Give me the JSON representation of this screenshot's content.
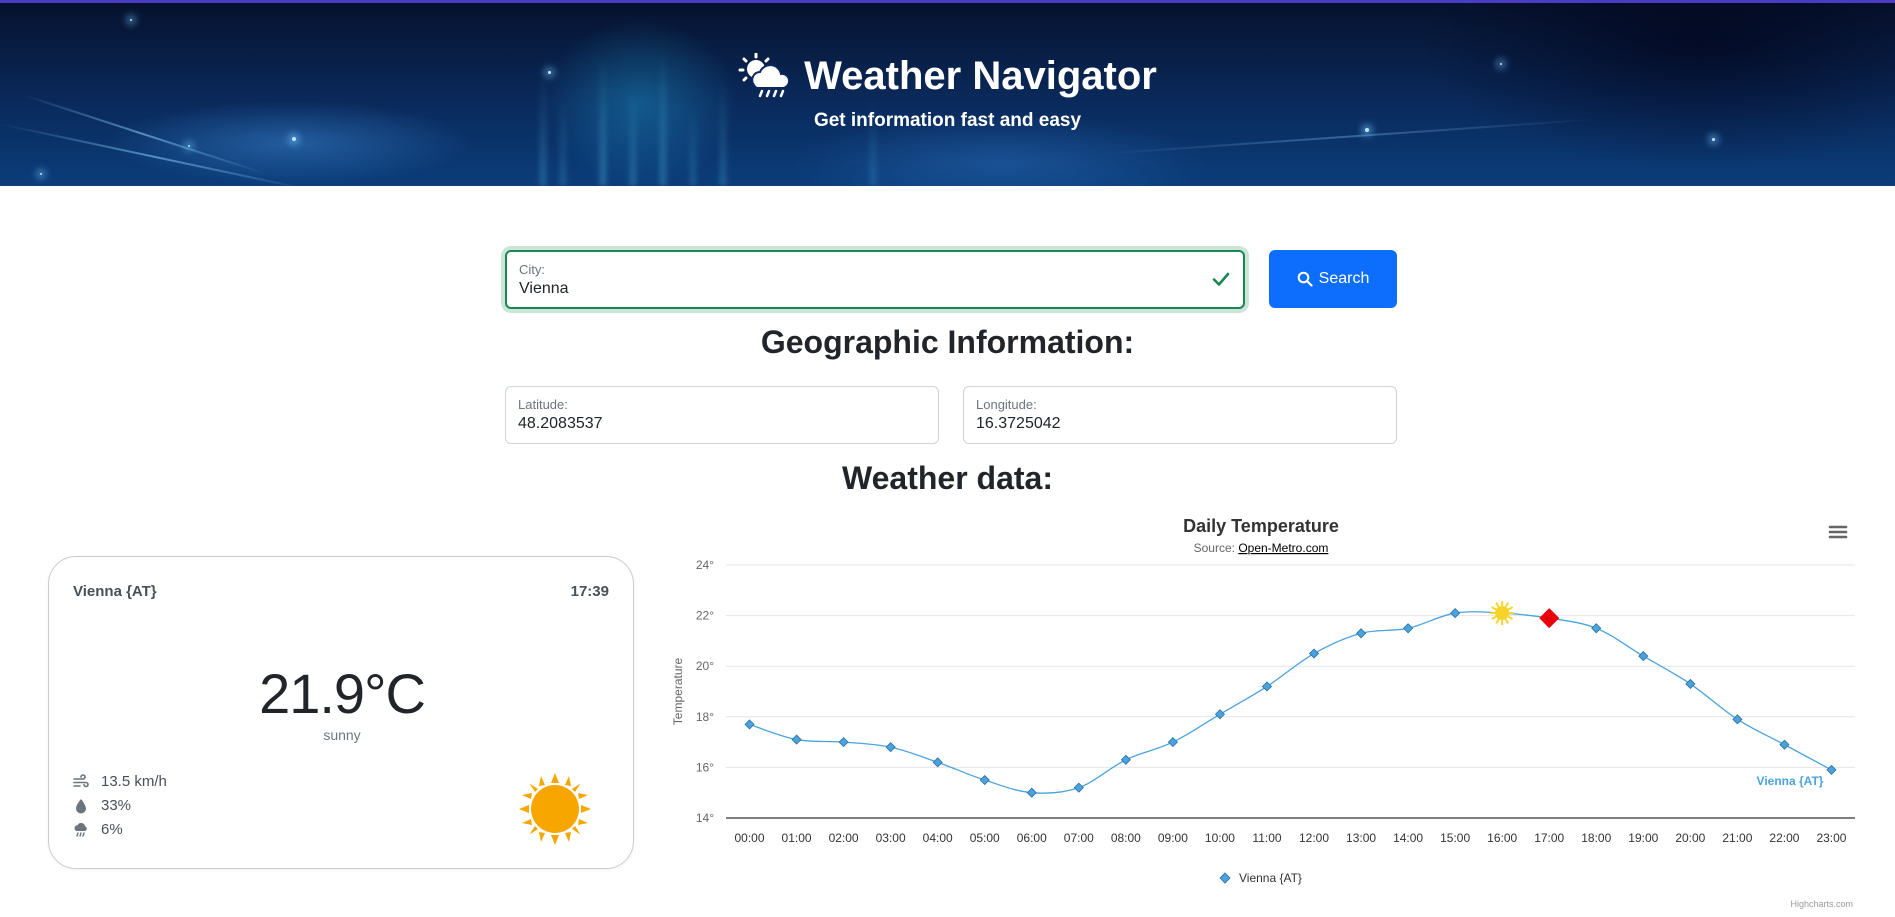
{
  "header": {
    "title": "Weather Navigator",
    "subtitle": "Get information fast and easy"
  },
  "search": {
    "city_label": "City:",
    "city_value": "Vienna",
    "button_label": "Search"
  },
  "geo": {
    "heading": "Geographic Information:",
    "latitude_label": "Latitude:",
    "latitude_value": "48.2083537",
    "longitude_label": "Longitude:",
    "longitude_value": "16.3725042"
  },
  "weather": {
    "heading": "Weather data:",
    "card": {
      "city": "Vienna {AT}",
      "time": "17:39",
      "temperature": "21.9°C",
      "condition": "sunny",
      "wind": "13.5 km/h",
      "humidity": "33%",
      "precipitation": "6%",
      "icon": "sun-icon"
    }
  },
  "chart_data": {
    "type": "line",
    "title": "Daily Temperature",
    "subtitle_prefix": "Source: ",
    "subtitle_link": "Open-Metro.com",
    "ylabel": "Temperature",
    "ylim": [
      14,
      24
    ],
    "yticks": [
      "24°",
      "22°",
      "20°",
      "18°",
      "16°",
      "14°"
    ],
    "categories": [
      "00:00",
      "01:00",
      "02:00",
      "03:00",
      "04:00",
      "05:00",
      "06:00",
      "07:00",
      "08:00",
      "09:00",
      "10:00",
      "11:00",
      "12:00",
      "13:00",
      "14:00",
      "15:00",
      "16:00",
      "17:00",
      "18:00",
      "19:00",
      "20:00",
      "21:00",
      "22:00",
      "23:00"
    ],
    "series": [
      {
        "name": "Vienna {AT}",
        "color": "#4aa3df",
        "values": [
          17.7,
          17.1,
          17.0,
          16.8,
          16.2,
          15.5,
          15.0,
          15.2,
          16.3,
          17.0,
          18.1,
          19.2,
          20.5,
          21.3,
          21.5,
          22.1,
          22.1,
          21.9,
          21.5,
          20.4,
          19.3,
          17.9,
          16.9,
          15.9
        ]
      }
    ],
    "markers": {
      "sun_at_index": 16,
      "current_at_index": 17,
      "current_color": "#e8000b",
      "sun_color": "#f5d327"
    },
    "grid": true,
    "legend": "bottom-center",
    "credit": "Highcharts.com"
  }
}
